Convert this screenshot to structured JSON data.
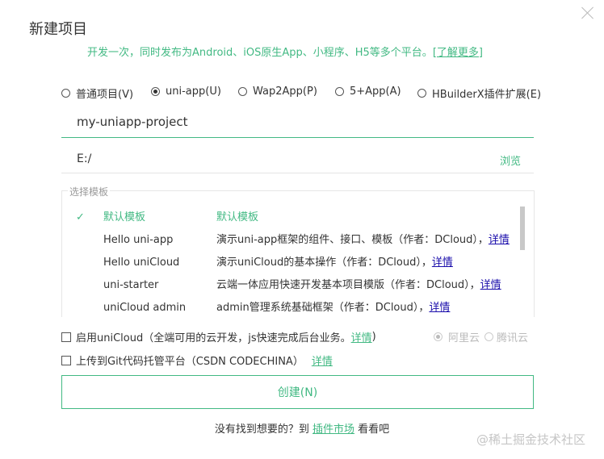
{
  "dialog": {
    "title": "新建项目",
    "subtitle_text": "开发一次，同时发布为Android、iOS原生App、小程序、H5等多个平台。",
    "subtitle_link": "[了解更多]"
  },
  "project_types": [
    {
      "label": "普通项目(V)",
      "checked": false
    },
    {
      "label": "uni-app(U)",
      "checked": true
    },
    {
      "label": "Wap2App(P)",
      "checked": false
    },
    {
      "label": "5+App(A)",
      "checked": false
    },
    {
      "label": "HBuilderX插件扩展(E)",
      "checked": false
    }
  ],
  "project_name": {
    "value": "my-uniapp-project"
  },
  "location": {
    "value": "E:/",
    "browse_label": "浏览"
  },
  "templates": {
    "legend": "选择模板",
    "items": [
      {
        "name": "默认模板",
        "desc": "默认模板",
        "link": "",
        "selected": true
      },
      {
        "name": "Hello uni-app",
        "desc": "演示uni-app框架的组件、接口、模板（作者：DCloud），",
        "link": "详情",
        "selected": false
      },
      {
        "name": "Hello uniCloud",
        "desc": "演示uniCloud的基本操作（作者：DCloud），",
        "link": "详情",
        "selected": false
      },
      {
        "name": "uni-starter",
        "desc": "云端一体应用快速开发基本项目模版（作者：DCloud），",
        "link": "详情",
        "selected": false
      },
      {
        "name": "uniCloud admin",
        "desc": "admin管理系统基础框架（作者：DCloud），",
        "link": "详情",
        "selected": false
      }
    ]
  },
  "options": {
    "unicloud_label": "启用uniCloud（全端可用的云开发，js快速完成后台业务。",
    "unicloud_link": "详情",
    "unicloud_suffix": ")",
    "cloud_providers": [
      "阿里云",
      "腾讯云"
    ],
    "git_label": "上传到Git代码托管平台（CSDN CODECHINA）",
    "git_link": "详情"
  },
  "create_button": "创建(N)",
  "footer": {
    "prefix": "没有找到想要的？到",
    "link": "插件市场",
    "suffix": "看看吧"
  },
  "watermark": "@稀土掘金技术社区",
  "colors": {
    "accent": "#42b983",
    "link_blue": "#1a0dab"
  }
}
